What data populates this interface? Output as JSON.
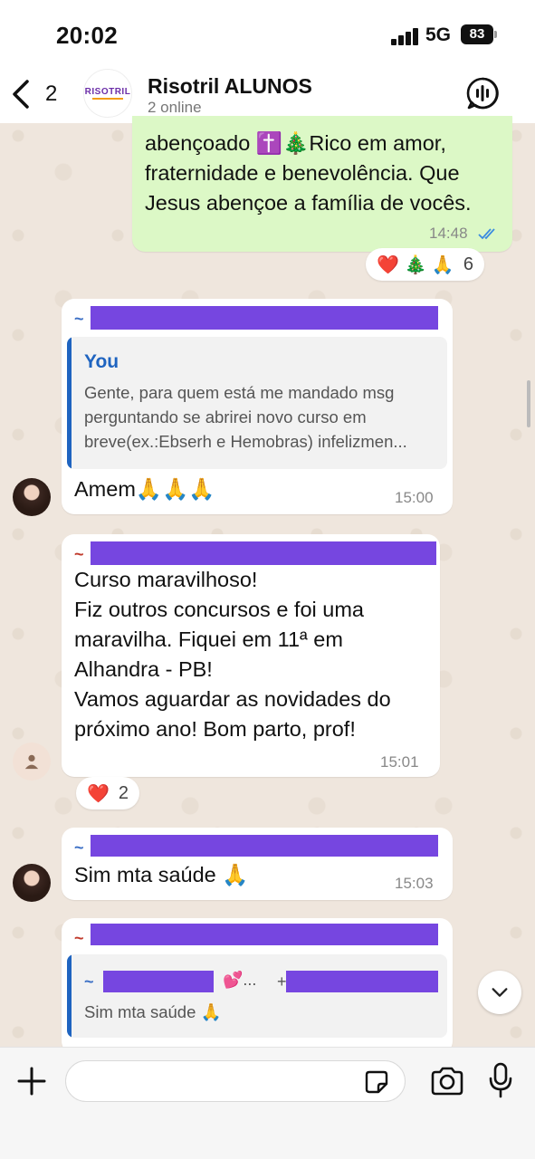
{
  "status_bar": {
    "time": "20:02",
    "network": "5G",
    "battery": "83"
  },
  "header": {
    "back_count": "2",
    "group_name": "Risotril ALUNOS",
    "group_status": "2 online",
    "logo_text": "RISOTRIL"
  },
  "messages": [
    {
      "direction": "outgoing",
      "text": "abençoado ✝️🎄Rico em amor,\nfraternidade e benevolência. Que\nJesus abençoe a família de vocês.",
      "time": "14:48",
      "reactions": "❤️ 🎄 🙏",
      "reaction_count": "6"
    },
    {
      "direction": "incoming",
      "sender_prefix": "~",
      "quote_author": "You",
      "quote_text": "Gente, para quem está me mandado msg\nperguntando se abrirei novo curso em\nbreve(ex.:Ebserh e Hemobras) infelizmen...",
      "text": "Amem🙏🙏🙏",
      "time": "15:00"
    },
    {
      "direction": "incoming",
      "sender_prefix": "~",
      "text": "Curso maravilhoso!\nFiz outros concursos e foi uma\nmaravilha. Fiquei em 11ª em\nAlhandra - PB!\nVamos aguardar as novidades do\npróximo ano! Bom parto, prof!",
      "time": "15:01",
      "reactions": "❤️",
      "reaction_count": "2"
    },
    {
      "direction": "incoming",
      "sender_prefix": "~",
      "text": "Sim mta saúde 🙏",
      "time": "15:03"
    },
    {
      "direction": "incoming",
      "sender_prefix": "~",
      "quote_prefix": "~",
      "quote_emoji": "💕...",
      "quote_plus": "+",
      "quote_text": "Sim mta saúde 🙏"
    }
  ],
  "composer": {
    "placeholder": ""
  },
  "colors": {
    "outgoing_bubble": "#dcf8c6",
    "accent_blue": "#1f64c0",
    "redaction": "#7646e0"
  },
  "icons": [
    "back-chevron-icon",
    "voice-chat-icon",
    "check-double-icon",
    "user-placeholder-icon",
    "chevron-down-icon",
    "plus-icon",
    "sticker-icon",
    "camera-icon",
    "mic-icon"
  ]
}
